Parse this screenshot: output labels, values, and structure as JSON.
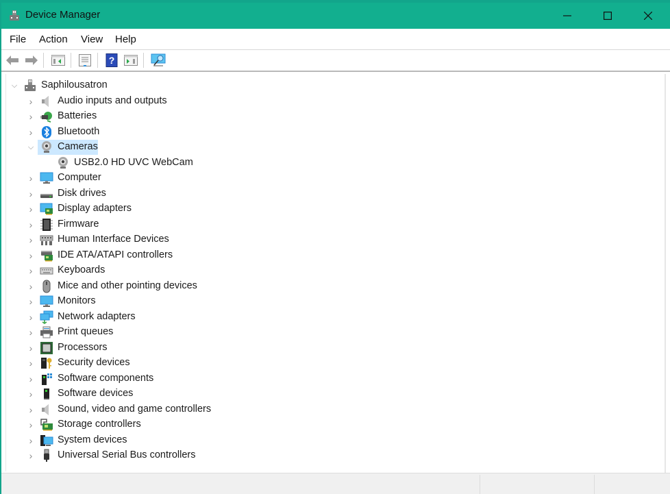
{
  "window": {
    "title": "Device Manager",
    "title_bar_color": "#12af8f",
    "controls": {
      "minimize": "minimize-icon",
      "maximize": "maximize-icon",
      "close": "close-icon"
    }
  },
  "menu": [
    "File",
    "Action",
    "View",
    "Help"
  ],
  "toolbar": [
    {
      "name": "back",
      "icon": "arrow-left-icon",
      "enabled": false
    },
    {
      "name": "forward",
      "icon": "arrow-right-icon",
      "enabled": false
    },
    {
      "name": "show-hide-console-tree",
      "icon": "console-tree-icon"
    },
    {
      "name": "properties",
      "icon": "properties-icon"
    },
    {
      "name": "help",
      "icon": "help-icon"
    },
    {
      "name": "show-action-pane",
      "icon": "action-pane-icon"
    },
    {
      "name": "scan-hardware",
      "icon": "monitor-scan-icon"
    }
  ],
  "tree": {
    "root": {
      "label": "Saphilousatron",
      "icon": "computer-root-icon",
      "expanded": true
    },
    "categories": [
      {
        "label": "Audio inputs and outputs",
        "icon": "speaker-icon",
        "expanded": false
      },
      {
        "label": "Batteries",
        "icon": "battery-icon",
        "expanded": false
      },
      {
        "label": "Bluetooth",
        "icon": "bluetooth-icon",
        "expanded": false
      },
      {
        "label": "Cameras",
        "icon": "webcam-icon",
        "expanded": true,
        "selected": true,
        "children": [
          {
            "label": "USB2.0 HD UVC WebCam",
            "icon": "webcam-icon"
          }
        ]
      },
      {
        "label": "Computer",
        "icon": "computer-icon",
        "expanded": false
      },
      {
        "label": "Disk drives",
        "icon": "disk-drive-icon",
        "expanded": false
      },
      {
        "label": "Display adapters",
        "icon": "display-adapter-icon",
        "expanded": false
      },
      {
        "label": "Firmware",
        "icon": "chip-icon",
        "expanded": false
      },
      {
        "label": "Human Interface Devices",
        "icon": "hid-icon",
        "expanded": false
      },
      {
        "label": "IDE ATA/ATAPI controllers",
        "icon": "ide-controller-icon",
        "expanded": false
      },
      {
        "label": "Keyboards",
        "icon": "keyboard-icon",
        "expanded": false
      },
      {
        "label": "Mice and other pointing devices",
        "icon": "mouse-icon",
        "expanded": false
      },
      {
        "label": "Monitors",
        "icon": "monitor-icon",
        "expanded": false
      },
      {
        "label": "Network adapters",
        "icon": "network-icon",
        "expanded": false
      },
      {
        "label": "Print queues",
        "icon": "printer-icon",
        "expanded": false
      },
      {
        "label": "Processors",
        "icon": "processor-icon",
        "expanded": false
      },
      {
        "label": "Security devices",
        "icon": "security-key-icon",
        "expanded": false
      },
      {
        "label": "Software components",
        "icon": "software-component-icon",
        "expanded": false
      },
      {
        "label": "Software devices",
        "icon": "software-device-icon",
        "expanded": false
      },
      {
        "label": "Sound, video and game controllers",
        "icon": "speaker-icon",
        "expanded": false
      },
      {
        "label": "Storage controllers",
        "icon": "storage-controller-icon",
        "expanded": false
      },
      {
        "label": "System devices",
        "icon": "system-devices-icon",
        "expanded": false
      },
      {
        "label": "Universal Serial Bus controllers",
        "icon": "usb-icon",
        "expanded": false
      }
    ]
  },
  "colors": {
    "selection": "#cce8ff",
    "accent": "#12af8f"
  }
}
